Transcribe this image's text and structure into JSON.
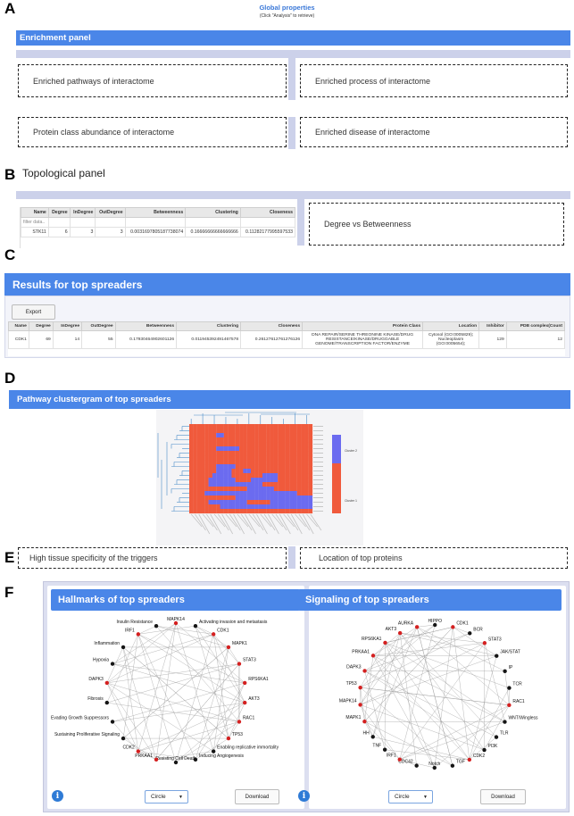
{
  "letters": {
    "a": "A",
    "b": "B",
    "c": "C",
    "d": "D",
    "e": "E",
    "f": "F"
  },
  "global": {
    "title": "Global properties",
    "subtitle": "(Click \"Analysis\" to retrieve)"
  },
  "enrichment": {
    "title": "Enrichment panel",
    "boxes": [
      "Enriched pathways of interactome",
      "Enriched process of interactome",
      "Protein class abundance of interactome",
      "Enriched disease of interactome"
    ]
  },
  "topological": {
    "title": "Topological panel",
    "filter": "filter data..",
    "columns": [
      "Name",
      "Degree",
      "InDegree",
      "OutDegree",
      "Betweenness",
      "Clustering",
      "Closeness"
    ],
    "row": [
      "STK11",
      "6",
      "3",
      "3",
      "0.0031697805187738074",
      "0.16666666666666666",
      "0.11282177995597533"
    ],
    "box": "Degree vs Betweenness"
  },
  "spreaders": {
    "title": "Results for top spreaders",
    "export": "Export",
    "columns": [
      "Name",
      "Degree",
      "InDegree",
      "OutDegree",
      "Betweenness",
      "Clustering",
      "Closeness",
      "Protein Class",
      "Location",
      "Inhibitor",
      "PDB complex(Count"
    ],
    "row": [
      "CDK1",
      "69",
      "14",
      "55",
      "0.17930464902601126",
      "0.011945392491467578",
      "0.26127612761276126",
      "DNA REPAIR/SERINE THREONINE KINASE/DRUG RESISTANCE/KINASE/DRUGGABLE GENOME/TRANSCRIPTION FACTOR/ENZYME",
      "Cytosol (GO:0005829); Nucleoplasm (GO:0005654);",
      "129",
      "12"
    ]
  },
  "clustergram": {
    "title": "Pathway clustergram of top spreaders",
    "legend": [
      "Cluster 2",
      "Cluster 1"
    ],
    "colors": {
      "red": "#f05a3c",
      "blue": "#6b6bf0"
    }
  },
  "section_e": {
    "boxes": [
      "High tissue specificity of the triggers",
      "Location of top proteins"
    ]
  },
  "hallmarks": {
    "title": "Hallmarks of top spreaders",
    "select": "Circle",
    "download": "Download",
    "nodes": [
      "MAPK14",
      "Activating invasion and metastasis",
      "CDK1",
      "MAPK1",
      "STAT3",
      "RPS6KA1",
      "AKT3",
      "RAC1",
      "TP53",
      "Enabling replicative immortality",
      "Inducing Angiogenesis",
      "Resisting Cell Death",
      "PRKAA1",
      "CDK2",
      "Sustaining Proliferative Signaling",
      "Evading Growth Suppressors",
      "Fibrosis",
      "DAPK3",
      "Hypoxia",
      "Inflammation",
      "IRF1",
      "Insulin Resistance"
    ],
    "red": [
      0,
      2,
      3,
      4,
      5,
      6,
      7,
      8,
      12,
      13,
      17,
      20
    ]
  },
  "signaling": {
    "title": "Signaling of top spreaders",
    "select": "Circle",
    "download": "Download",
    "nodes": [
      "CDK1",
      "BCR",
      "STAT3",
      "JAK/STAT",
      "IP",
      "TCR",
      "RAC1",
      "WNT/Wingless",
      "TLR",
      "PI3K",
      "CDK2",
      "TGF",
      "Notch",
      "CDC42",
      "IRF1",
      "TNF",
      "HH",
      "MAPK1",
      "MAPK14",
      "TP53",
      "DAPK3",
      "PRKAA1",
      "RPS6KA1",
      "AKT3",
      "AURKA",
      "HIPPO"
    ],
    "red": [
      0,
      2,
      6,
      10,
      14,
      17,
      18,
      19,
      20,
      21,
      22,
      23,
      24
    ]
  }
}
